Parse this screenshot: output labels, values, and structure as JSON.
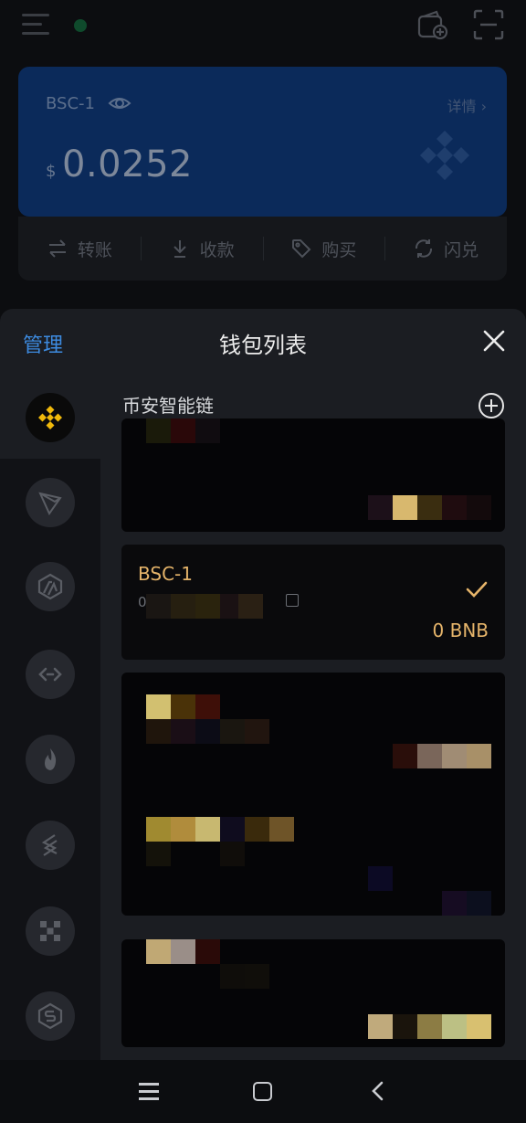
{
  "header": {
    "status_color": "#0f4a2c"
  },
  "card": {
    "wallet_name": "BSC-1",
    "details_label": "详情 ›",
    "currency_symbol": "$",
    "balance": "0.0252"
  },
  "actions": [
    {
      "label": "转账",
      "icon": "transfer-icon"
    },
    {
      "label": "收款",
      "icon": "receive-icon"
    },
    {
      "label": "购买",
      "icon": "tag-icon"
    },
    {
      "label": "闪兑",
      "icon": "swap-icon"
    }
  ],
  "sheet": {
    "manage_label": "管理",
    "title": "钱包列表",
    "chain_label": "币安智能链",
    "chains": [
      "binance-icon",
      "tron-icon",
      "arbitrum-icon",
      "bridge-icon",
      "fantom-icon",
      "linea-icon",
      "okx-icon",
      "solana-style-icon"
    ],
    "selected_wallet": {
      "name": "BSC-1",
      "address": "0x              A",
      "balance": "0 BNB"
    }
  },
  "colors": {
    "accent_gold": "#e5b46a",
    "link_blue": "#3d8be0",
    "card_blue": "#0b2a5a"
  }
}
